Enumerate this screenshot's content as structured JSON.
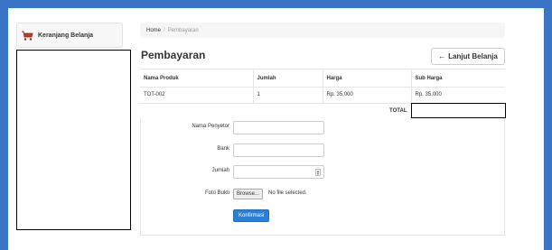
{
  "colors": {
    "frame": "#3a74c4",
    "primary_button": "#2a7fd8",
    "cart_icon": "#c0392b"
  },
  "sidebar": {
    "cart_title": "Keranjang Belanja",
    "cart_icon": "shopping-cart-icon"
  },
  "breadcrumb": {
    "home": "Home",
    "separator": "/",
    "current": "Pembayaran"
  },
  "page": {
    "title": "Pembayaran",
    "continue_button": "Lanjut Belanja",
    "continue_icon": "arrow-left-icon"
  },
  "table": {
    "headers": [
      "Nama Produk",
      "Jumlah",
      "Harga",
      "Sub Harga"
    ],
    "rows": [
      [
        "TOT-002",
        "1",
        "Rp. 35,000",
        "Rp. 35,000"
      ]
    ],
    "total_label": "TOTAL"
  },
  "form": {
    "depositor_label": "Nama Penyetor",
    "depositor_value": "",
    "bank_label": "Bank",
    "bank_value": "",
    "amount_label": "Jumlah",
    "amount_value": "",
    "proof_label": "Foto Bukti",
    "browse_label": "Browse...",
    "no_file_text": "No file selected.",
    "submit_label": "Konfirmasi"
  }
}
